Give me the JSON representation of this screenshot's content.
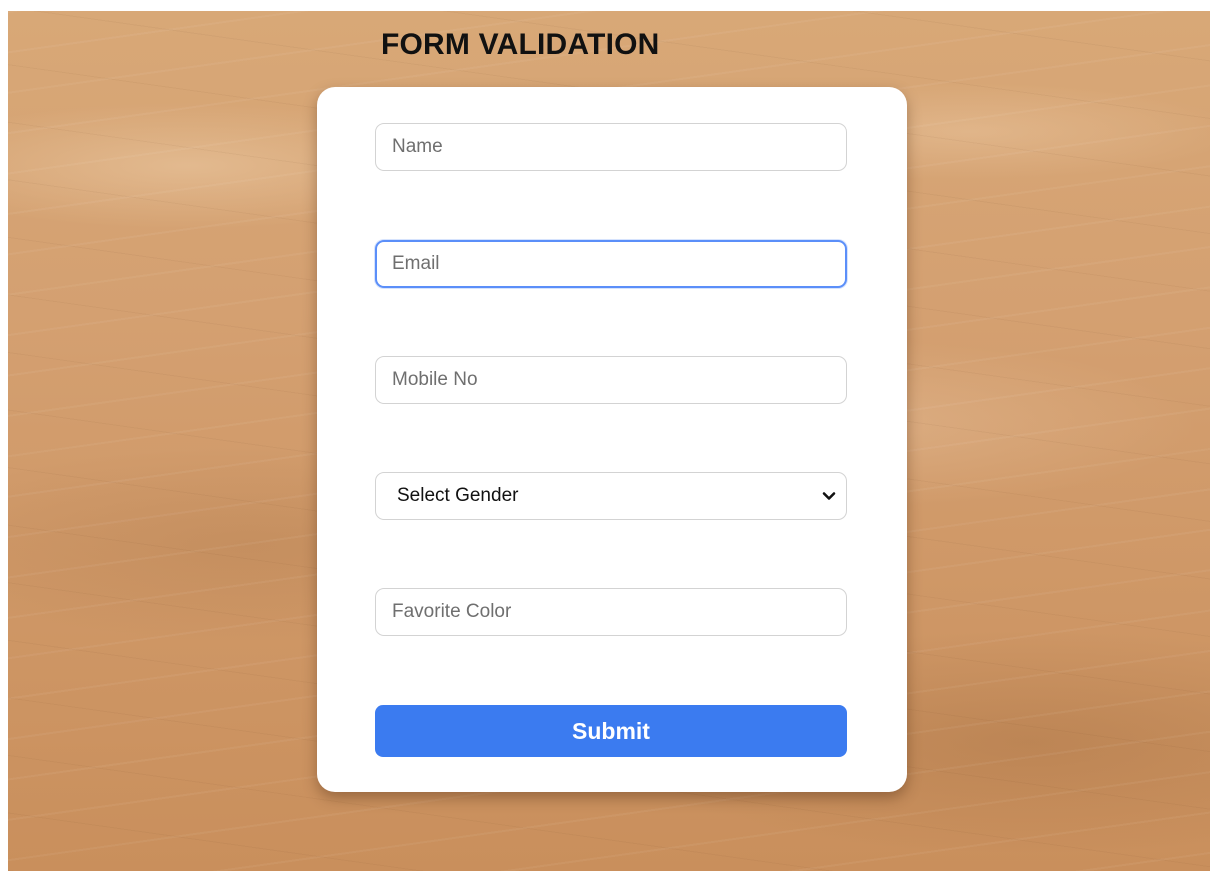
{
  "header": {
    "title": "FORM VALIDATION"
  },
  "form": {
    "name_field": {
      "placeholder": "Name",
      "value": ""
    },
    "email_field": {
      "placeholder": "Email",
      "value": "",
      "focused": true
    },
    "mobile_field": {
      "placeholder": "Mobile No",
      "value": ""
    },
    "gender_select": {
      "selected": "Select Gender",
      "icon": "chevron-down-icon"
    },
    "color_field": {
      "placeholder": "Favorite Color",
      "value": ""
    },
    "submit_label": "Submit"
  },
  "colors": {
    "accent": "#3b7bf0",
    "focus_border": "#5b8ff9",
    "background": "#d4a071",
    "card": "#ffffff"
  }
}
